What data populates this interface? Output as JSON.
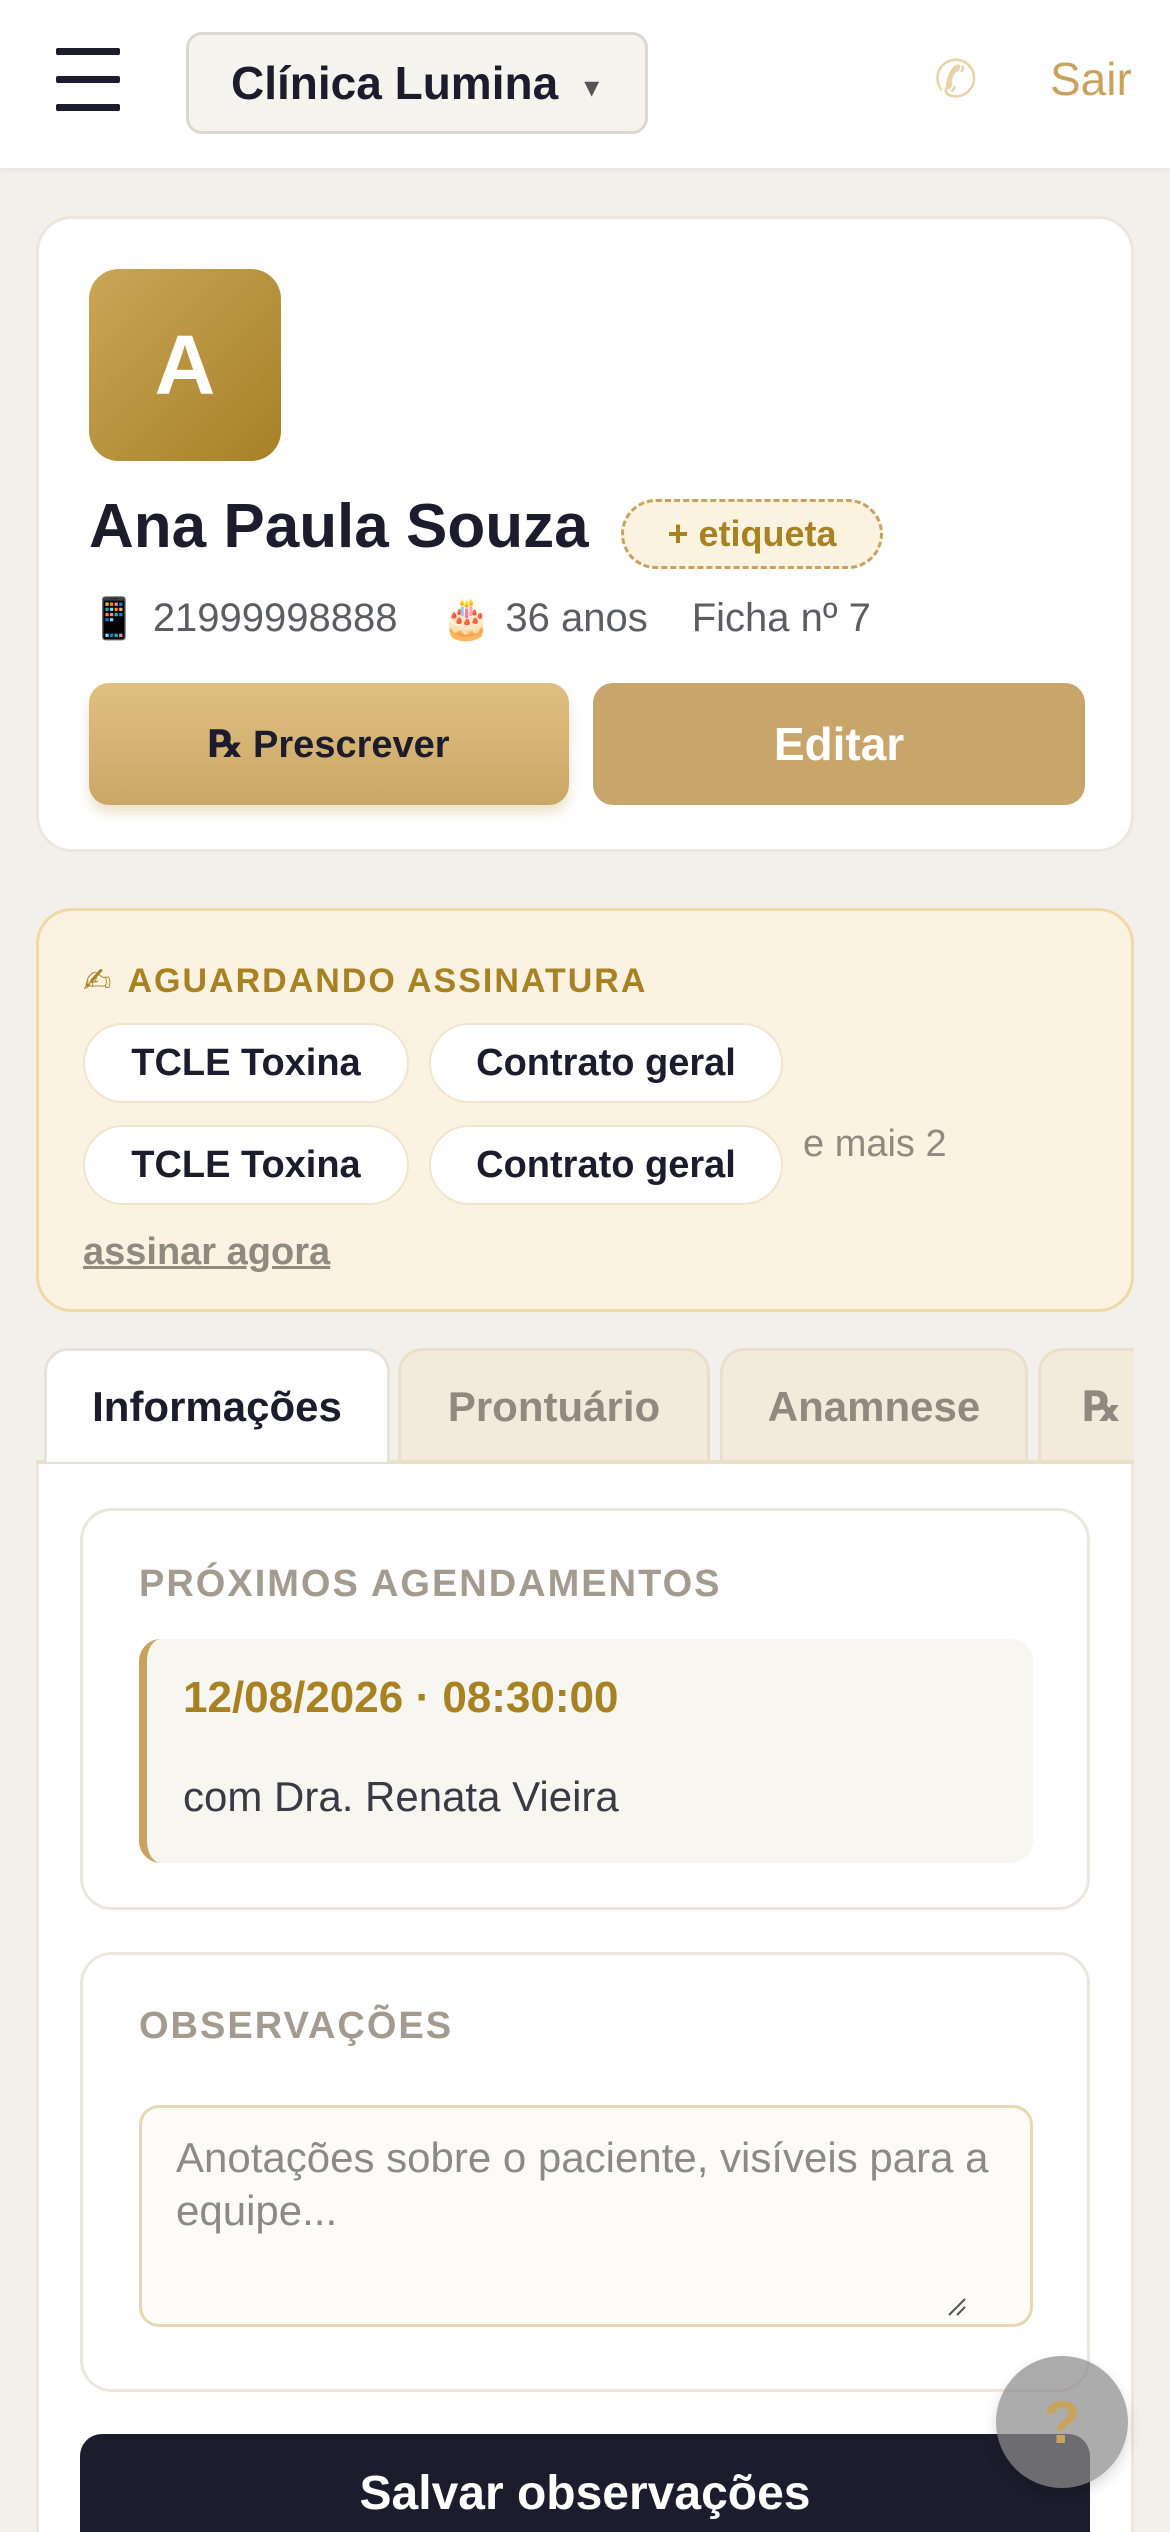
{
  "header": {
    "clinic_name": "Clínica Lumina",
    "clinic_caret": "▾",
    "phone_glyph": "✆",
    "logout_label": "Sair"
  },
  "patient": {
    "avatar_initial": "A",
    "name": "Ana Paula Souza",
    "tag_label": "+ etiqueta",
    "phone_icon": "📱",
    "phone": "21999998888",
    "age_icon": "🎂",
    "age": "36 anos",
    "record": "Ficha nº 7",
    "prescribe_label": "℞ Prescrever",
    "edit_label": "Editar"
  },
  "signature": {
    "icon": "✍",
    "title": "AGUARDANDO ASSINATURA",
    "documents": [
      "TCLE Toxina",
      "Contrato geral",
      "TCLE Toxina",
      "Contrato geral"
    ],
    "more_text": "e mais 2",
    "action_label": "assinar agora"
  },
  "tabs": [
    "Informações",
    "Prontuário",
    "Anamnese",
    "℞"
  ],
  "appointments": {
    "title": "PRÓXIMOS AGENDAMENTOS",
    "items": [
      {
        "datetime": "12/08/2026 · 08:30:00",
        "doctor": "com Dra. Renata Vieira"
      }
    ]
  },
  "observations": {
    "title": "OBSERVAÇÕES",
    "placeholder": "Anotações sobre o paciente, visíveis para a equipe...",
    "value": "",
    "save_label": "Salvar observações"
  },
  "help_label": "?",
  "colors": {
    "accent_gold": "#c9a35d",
    "dark_navy": "#1c1c2c",
    "page_background": "#f3f0eb",
    "pending_background": "#fbf2e2"
  }
}
